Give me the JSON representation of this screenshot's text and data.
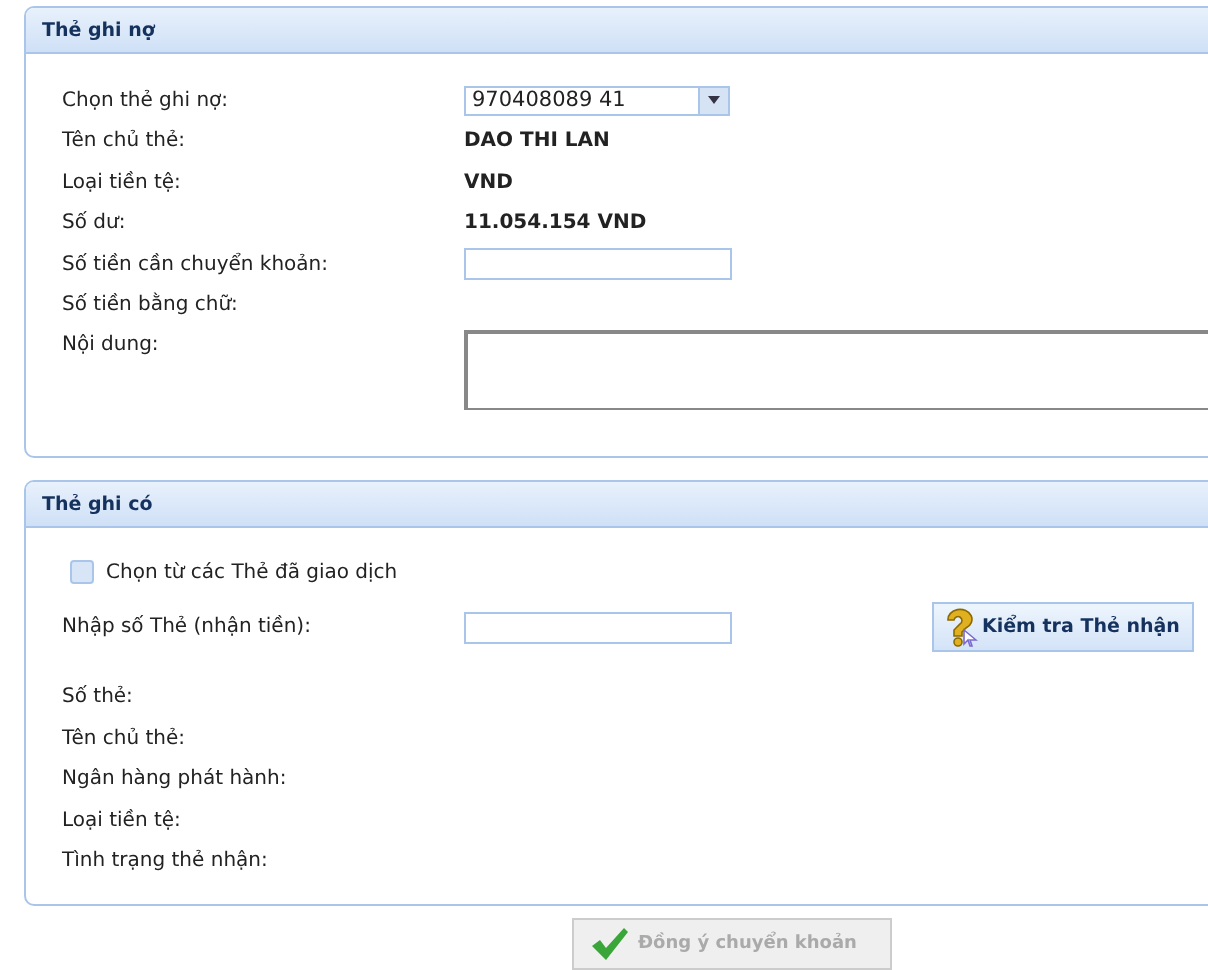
{
  "debit_panel": {
    "title": "Thẻ ghi nợ",
    "card_select": {
      "label": "Chọn thẻ ghi nợ:",
      "value": "970408089 41"
    },
    "info_rows": [
      {
        "label": "Tên chủ thẻ:",
        "value": "DAO THI LAN"
      },
      {
        "label": "Loại tiền tệ:",
        "value": "VND"
      },
      {
        "label": "Số dư:",
        "value": "11.054.154 VND"
      }
    ],
    "amount": {
      "label": "Số tiền cần chuyển khoản:"
    },
    "amount_words": {
      "label": "Số tiền bằng chữ:"
    },
    "content": {
      "label": "Nội dung:"
    }
  },
  "credit_panel": {
    "title": "Thẻ ghi có",
    "history_checkbox": {
      "label": "Chọn từ các Thẻ đã giao dịch",
      "checked": false
    },
    "card_input": {
      "label": "Nhập số Thẻ (nhận tiền):"
    },
    "check_button": {
      "label": "Kiểm tra Thẻ nhận"
    },
    "info_rows": [
      {
        "label": "Số thẻ:"
      },
      {
        "label": "Tên chủ thẻ:"
      },
      {
        "label": "Ngân hàng phát hành:"
      },
      {
        "label": "Loại tiền tệ:"
      },
      {
        "label": "Tình trạng thẻ nhận:"
      }
    ]
  },
  "submit_button": {
    "label": "Đồng ý chuyển khoản",
    "disabled": true
  }
}
